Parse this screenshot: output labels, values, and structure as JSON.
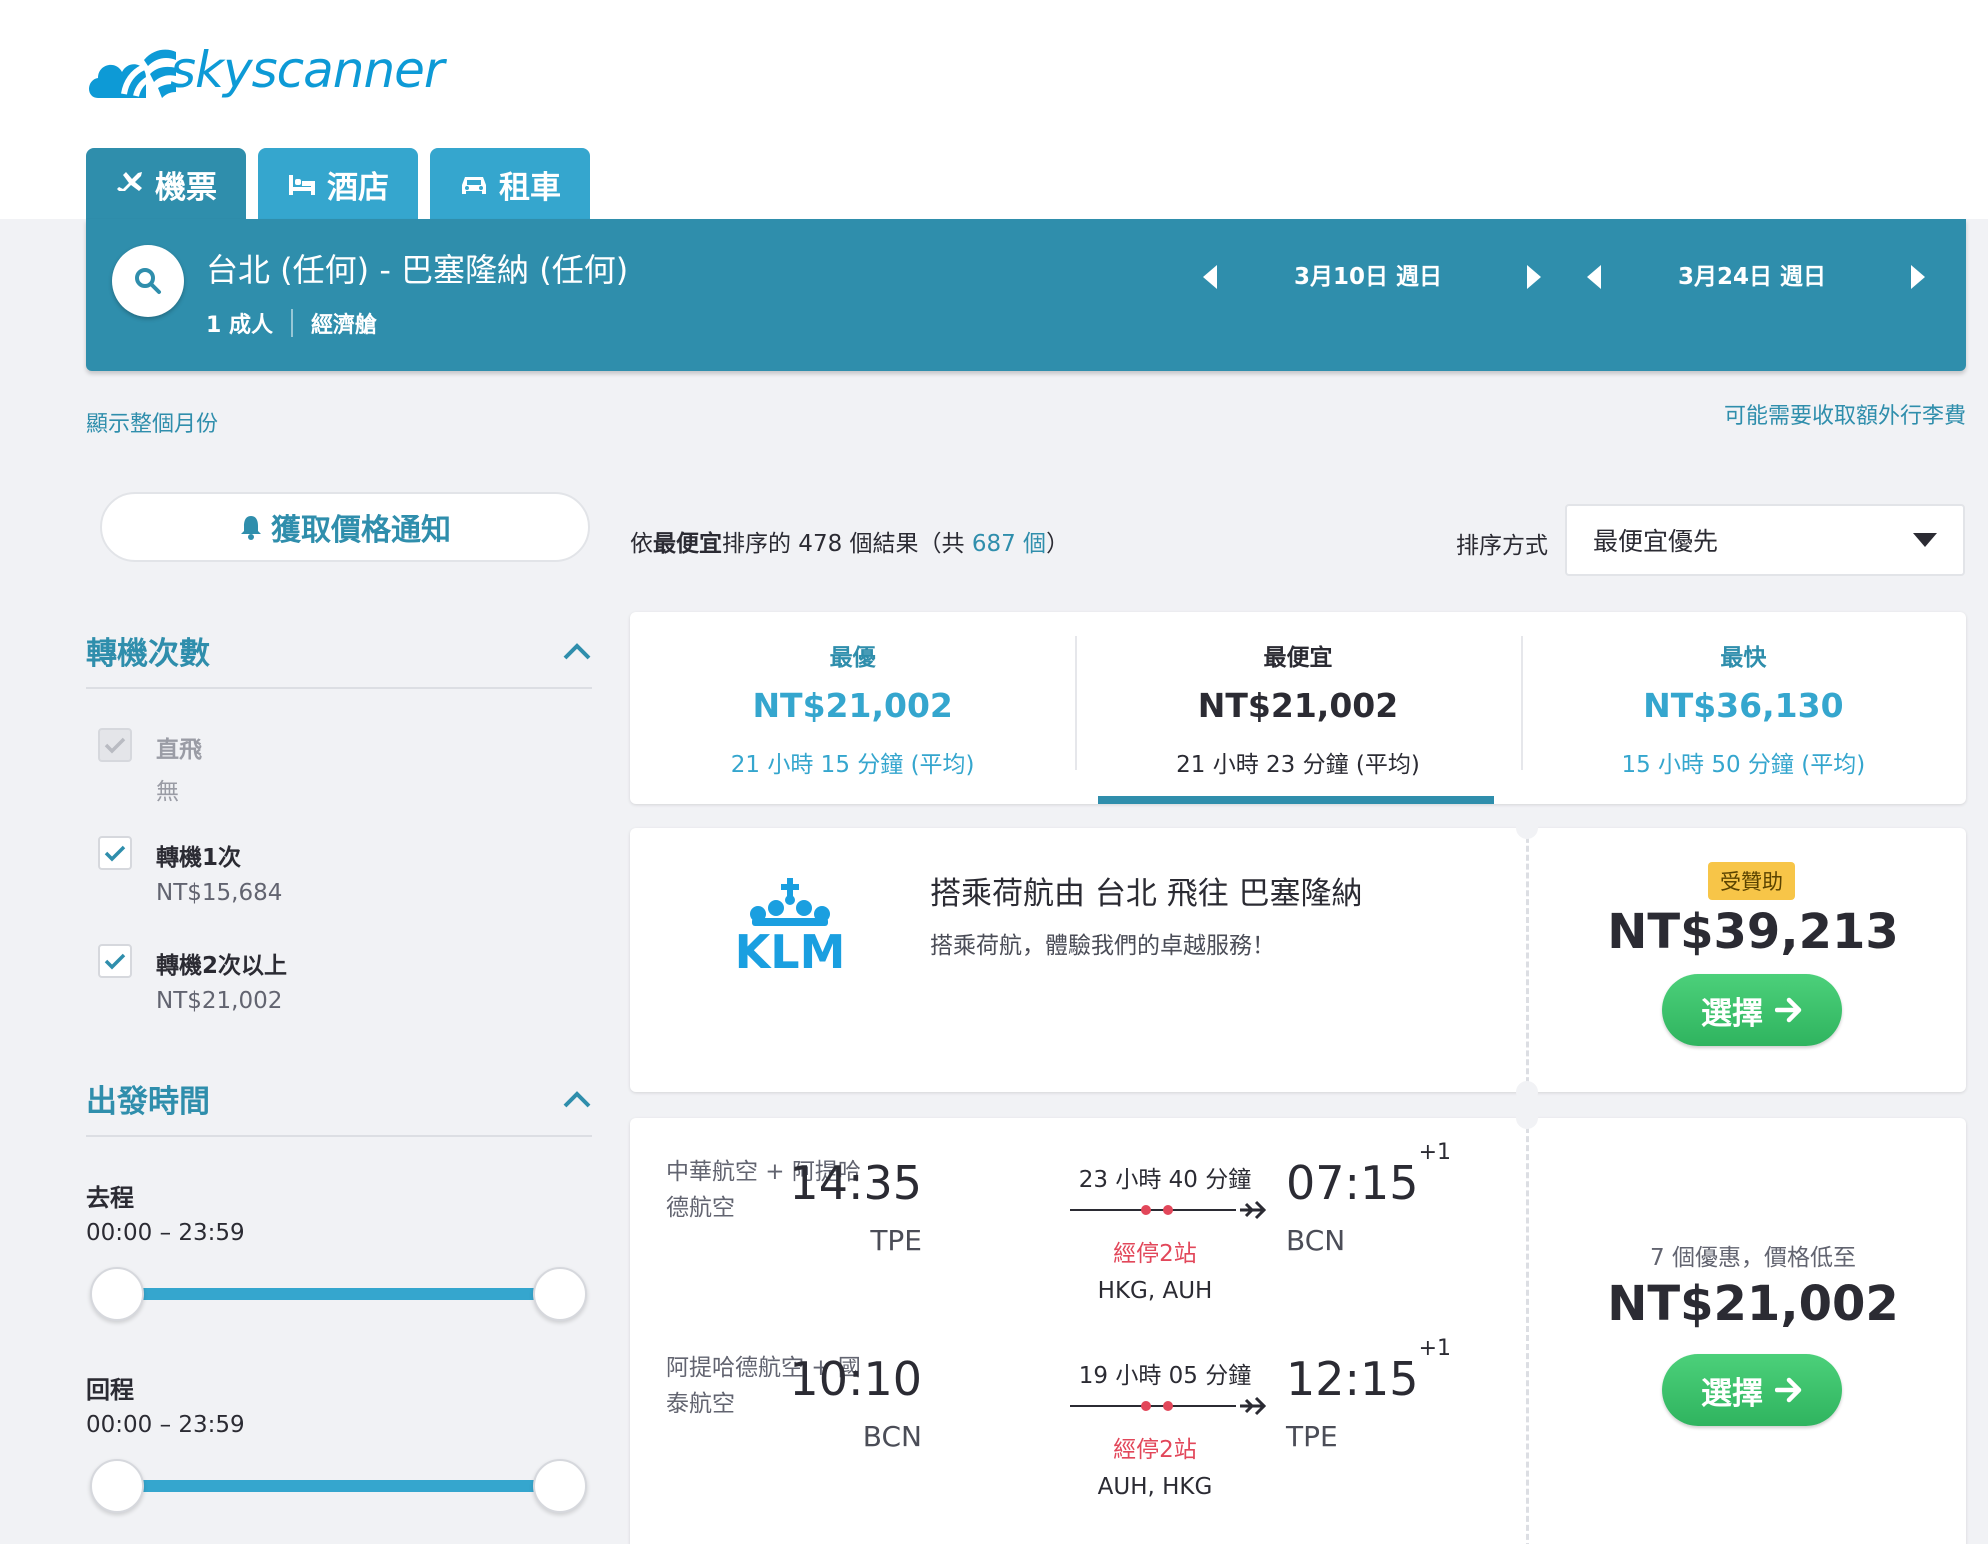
{
  "brand": {
    "name": "skyscanner",
    "color": "#0d9ad6"
  },
  "tabs": [
    {
      "label": "機票",
      "icon": "plane-icon"
    },
    {
      "label": "酒店",
      "icon": "bed-icon"
    },
    {
      "label": "租車",
      "icon": "car-icon"
    }
  ],
  "search": {
    "route": "台北 (任何) - 巴塞隆納 (任何)",
    "passengers": "1 成人",
    "cabin": "經濟艙",
    "depart_date": "3月10日 週日",
    "return_date": "3月24日 週日"
  },
  "links": {
    "show_month": "顯示整個月份",
    "baggage": "可能需要收取額外行李費"
  },
  "sidebar": {
    "price_alert": "獲取價格通知",
    "stops_title": "轉機次數",
    "stops": [
      {
        "label": "直飛",
        "sub": "無",
        "checked": true,
        "disabled": true
      },
      {
        "label": "轉機1次",
        "sub": "NT$15,684",
        "checked": true,
        "disabled": false
      },
      {
        "label": "轉機2次以上",
        "sub": "NT$21,002",
        "checked": true,
        "disabled": false
      }
    ],
    "times_title": "出發時間",
    "outbound_label": "去程",
    "outbound_range": "00:00 – 23:59",
    "return_label": "回程",
    "return_range": "00:00 – 23:59"
  },
  "results": {
    "prefix": "依",
    "sort_bold": "最便宜",
    "middle": "排序的 478 個結果（共 ",
    "total_link": "687 個",
    "suffix": "）",
    "sort_label": "排序方式",
    "sort_value": "最便宜優先"
  },
  "summary": [
    {
      "title": "最優",
      "price": "NT$21,002",
      "duration": "21 小時 15 分鐘 (平均)"
    },
    {
      "title": "最便宜",
      "price": "NT$21,002",
      "duration": "21 小時 23 分鐘 (平均)"
    },
    {
      "title": "最快",
      "price": "NT$36,130",
      "duration": "15 小時 50 分鐘 (平均)"
    }
  ],
  "ad": {
    "logo_text": "KLM",
    "title": "搭乘荷航由 台北 飛往 巴塞隆納",
    "subtitle": "搭乘荷航，體驗我們的卓越服務！",
    "badge": "受贊助",
    "price": "NT$39,213",
    "button": "選擇"
  },
  "itinerary": {
    "legs": [
      {
        "airline": "中華航空 + 阿提哈德航空",
        "dep_time": "14:35",
        "dep_code": "TPE",
        "duration": "23 小時 40 分鐘",
        "stops": "經停2站",
        "via": "HKG, AUH",
        "arr_time": "07:15",
        "arr_offset": "+1",
        "arr_code": "BCN"
      },
      {
        "airline": "阿提哈德航空 + 國泰航空",
        "dep_time": "10:10",
        "dep_code": "BCN",
        "duration": "19 小時 05 分鐘",
        "stops": "經停2站",
        "via": "AUH, HKG",
        "arr_time": "12:15",
        "arr_offset": "+1",
        "arr_code": "TPE"
      }
    ],
    "deals": "7 個優惠，價格低至",
    "price": "NT$21,002",
    "button": "選擇"
  }
}
